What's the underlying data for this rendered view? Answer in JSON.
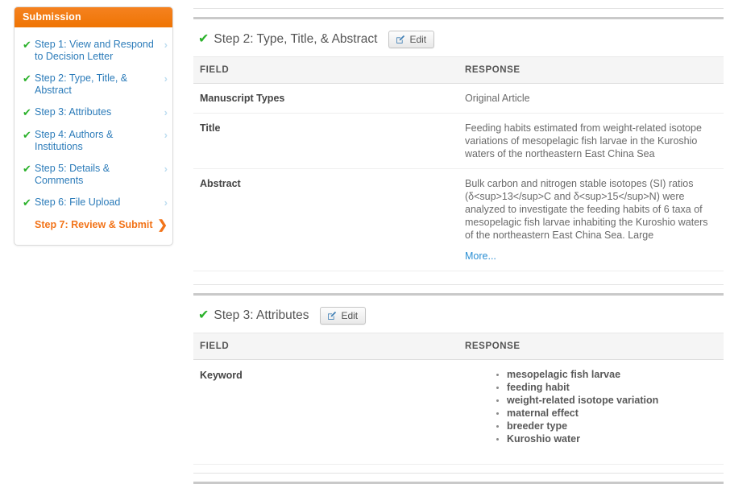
{
  "sidebar": {
    "header": "Submission",
    "items": [
      {
        "label": "Step 1: View and Respond to Decision Letter",
        "icon": "check-icon",
        "arrow": "›",
        "current": false
      },
      {
        "label": "Step 2: Type, Title, & Abstract",
        "icon": "check-icon",
        "arrow": "›",
        "current": false
      },
      {
        "label": "Step 3: Attributes",
        "icon": "check-icon",
        "arrow": "›",
        "current": false
      },
      {
        "label": "Step 4: Authors & Institutions",
        "icon": "check-icon",
        "arrow": "›",
        "current": false
      },
      {
        "label": "Step 5: Details & Comments",
        "icon": "check-icon",
        "arrow": "›",
        "current": false
      },
      {
        "label": "Step 6: File Upload",
        "icon": "check-icon",
        "arrow": "›",
        "current": false
      },
      {
        "label": "Step 7: Review & Submit",
        "icon": "",
        "arrow": "❯",
        "current": true
      }
    ]
  },
  "colors": {
    "brand_orange": "#f2741a",
    "header_orange": "#ef7403",
    "link_blue": "#2b7bb9",
    "check_green": "#2ab12a",
    "arrow_blue": "#bdddf0",
    "more_link_blue": "#2b8fd4"
  },
  "sections": [
    {
      "id": "step2",
      "check": "✔",
      "title": "Step 2: Type, Title, & Abstract",
      "edit_label": "Edit",
      "edit_icon": "edit-pencil-icon",
      "columns": [
        "FIELD",
        "RESPONSE"
      ],
      "rows": [
        {
          "field": "Manuscript Types",
          "value": "Original Article",
          "type": "text"
        },
        {
          "field": "Title",
          "value": "Feeding habits estimated from weight-related isotope variations of mesopelagic fish larvae in the Kuroshio waters of the northeastern East China Sea",
          "type": "text"
        },
        {
          "field": "Abstract",
          "value": "Bulk carbon and nitrogen stable isotopes (SI) ratios (δ<sup>13</sup>C and δ<sup>15</sup>N)  were analyzed to investigate the feeding habits of 6 taxa of mesopelagic fish larvae inhabiting the Kuroshio waters of the northeastern East China Sea. Large",
          "more_label": "More...",
          "type": "abstract"
        }
      ]
    },
    {
      "id": "step3",
      "check": "✔",
      "title": "Step 3: Attributes",
      "edit_label": "Edit",
      "edit_icon": "edit-pencil-icon",
      "columns": [
        "FIELD",
        "RESPONSE"
      ],
      "rows": [
        {
          "field": "Keyword",
          "type": "list",
          "items": [
            "mesopelagic fish larvae",
            "feeding habit",
            "weight-related isotope variation",
            "maternal effect",
            "breeder type",
            "Kuroshio water"
          ]
        }
      ]
    }
  ]
}
